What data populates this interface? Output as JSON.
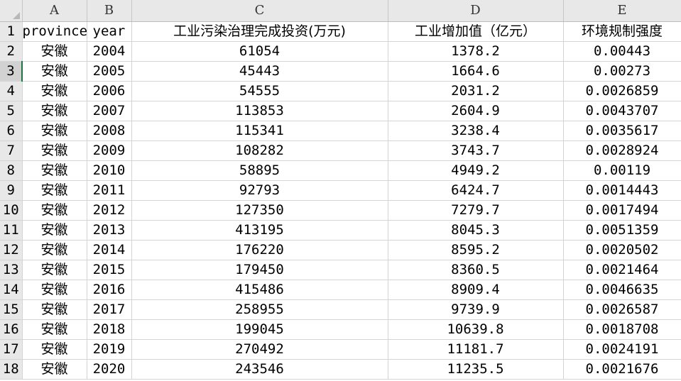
{
  "columns": [
    "A",
    "B",
    "C",
    "D",
    "E"
  ],
  "header_row": {
    "row_number": "1",
    "cells": [
      "province",
      "year",
      "工业污染治理完成投资(万元)",
      "工业增加值（亿元）",
      "环境规制强度"
    ]
  },
  "rows": [
    {
      "row_number": "2",
      "cells": [
        "安徽",
        "2004",
        "61054",
        "1378.2",
        "0.00443"
      ]
    },
    {
      "row_number": "3",
      "cells": [
        "安徽",
        "2005",
        "45443",
        "1664.6",
        "0.00273"
      ]
    },
    {
      "row_number": "4",
      "cells": [
        "安徽",
        "2006",
        "54555",
        "2031.2",
        "0.0026859"
      ]
    },
    {
      "row_number": "5",
      "cells": [
        "安徽",
        "2007",
        "113853",
        "2604.9",
        "0.0043707"
      ]
    },
    {
      "row_number": "6",
      "cells": [
        "安徽",
        "2008",
        "115341",
        "3238.4",
        "0.0035617"
      ]
    },
    {
      "row_number": "7",
      "cells": [
        "安徽",
        "2009",
        "108282",
        "3743.7",
        "0.0028924"
      ]
    },
    {
      "row_number": "8",
      "cells": [
        "安徽",
        "2010",
        "58895",
        "4949.2",
        "0.00119"
      ]
    },
    {
      "row_number": "9",
      "cells": [
        "安徽",
        "2011",
        "92793",
        "6424.7",
        "0.0014443"
      ]
    },
    {
      "row_number": "10",
      "cells": [
        "安徽",
        "2012",
        "127350",
        "7279.7",
        "0.0017494"
      ]
    },
    {
      "row_number": "11",
      "cells": [
        "安徽",
        "2013",
        "413195",
        "8045.3",
        "0.0051359"
      ]
    },
    {
      "row_number": "12",
      "cells": [
        "安徽",
        "2014",
        "176220",
        "8595.2",
        "0.0020502"
      ]
    },
    {
      "row_number": "13",
      "cells": [
        "安徽",
        "2015",
        "179450",
        "8360.5",
        "0.0021464"
      ]
    },
    {
      "row_number": "14",
      "cells": [
        "安徽",
        "2016",
        "415486",
        "8909.4",
        "0.0046635"
      ]
    },
    {
      "row_number": "15",
      "cells": [
        "安徽",
        "2017",
        "258955",
        "9739.9",
        "0.0026587"
      ]
    },
    {
      "row_number": "16",
      "cells": [
        "安徽",
        "2018",
        "199045",
        "10639.8",
        "0.0018708"
      ]
    },
    {
      "row_number": "17",
      "cells": [
        "安徽",
        "2019",
        "270492",
        "11181.7",
        "0.0024191"
      ]
    },
    {
      "row_number": "18",
      "cells": [
        "安徽",
        "2020",
        "243546",
        "11235.5",
        "0.0021676"
      ]
    }
  ]
}
